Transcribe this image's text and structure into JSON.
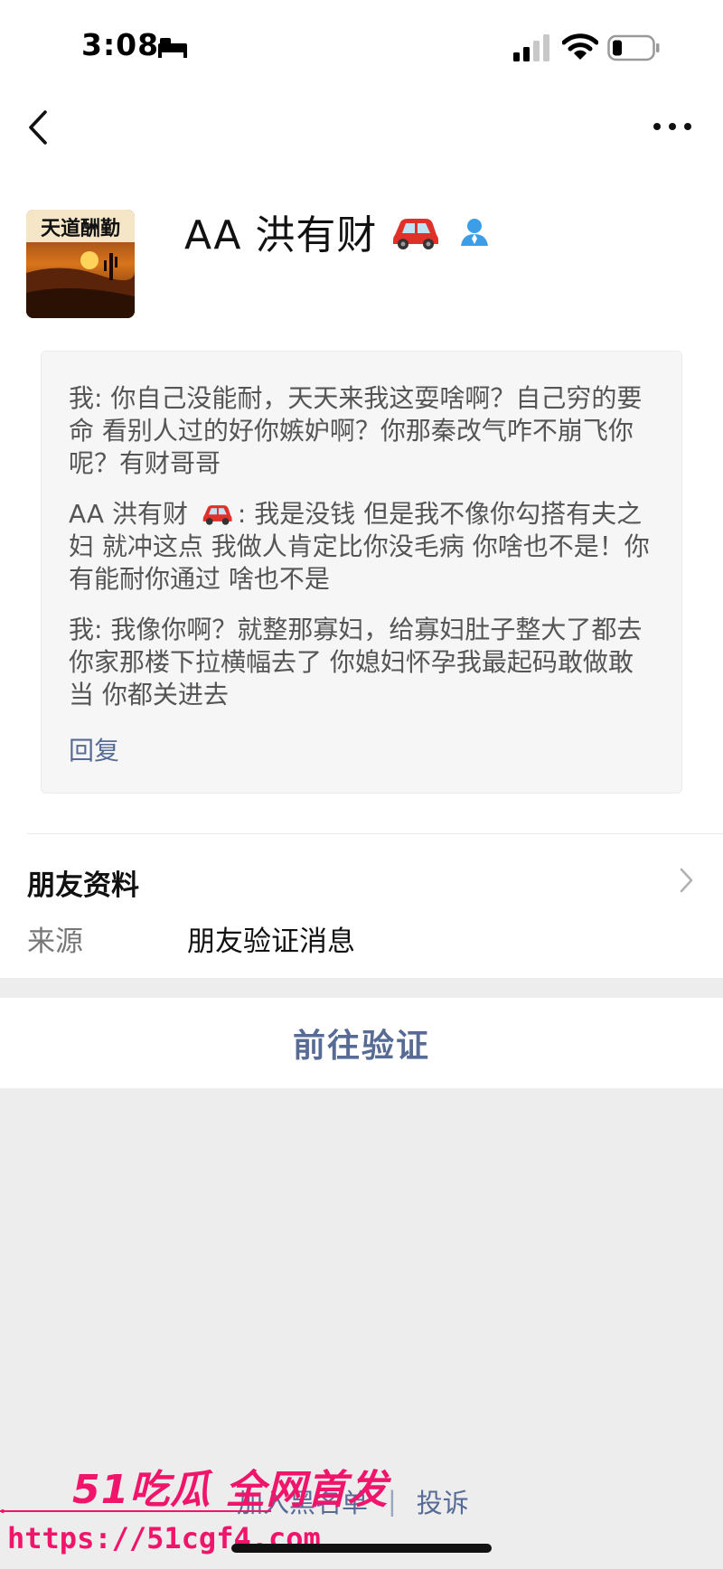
{
  "status_bar": {
    "time": "3:08",
    "icons": [
      "sleep-icon",
      "signal-icon",
      "wifi-icon",
      "battery-icon"
    ]
  },
  "nav": {
    "back_icon": "back-icon",
    "more_icon": "more-icon"
  },
  "profile": {
    "name": "AA 洪有财",
    "avatar_text": "天道酬勤",
    "name_icons": [
      "car-icon",
      "contact-icon"
    ]
  },
  "messages": [
    {
      "speaker": "我",
      "text": "我: 你自己没能耐，天天来我这耍啥啊？自己穷的要命 看别人过的好你嫉妒啊？你那秦改气咋不崩飞你呢？有财哥哥"
    },
    {
      "speaker": "AA 洪有财",
      "prefix": "AA 洪有财",
      "text": ": 我是没钱 但是我不像你勾搭有夫之妇 就冲这点 我做人肯定比你没毛病 你啥也不是！你有能耐你通过 啥也不是"
    },
    {
      "speaker": "我",
      "text": "我: 我像你啊？就整那寡妇，给寡妇肚子整大了都去你家那楼下拉横幅去了 你媳妇怀孕我最起码敢做敢当 你都关进去"
    }
  ],
  "reply_label": "回复",
  "friend_info": {
    "label": "朋友资料",
    "source_label": "来源",
    "source_value": "朋友验证消息"
  },
  "verify_button": "前往验证",
  "bottom_links": {
    "blacklist": "加入黑名单",
    "separator": "|",
    "report": "投诉"
  },
  "watermark": {
    "logo": "51吃瓜 全网首发",
    "url": "https://51cgf4.com"
  },
  "colors": {
    "link": "#576b95",
    "background": "#ededed",
    "watermark": "#f0156a"
  }
}
